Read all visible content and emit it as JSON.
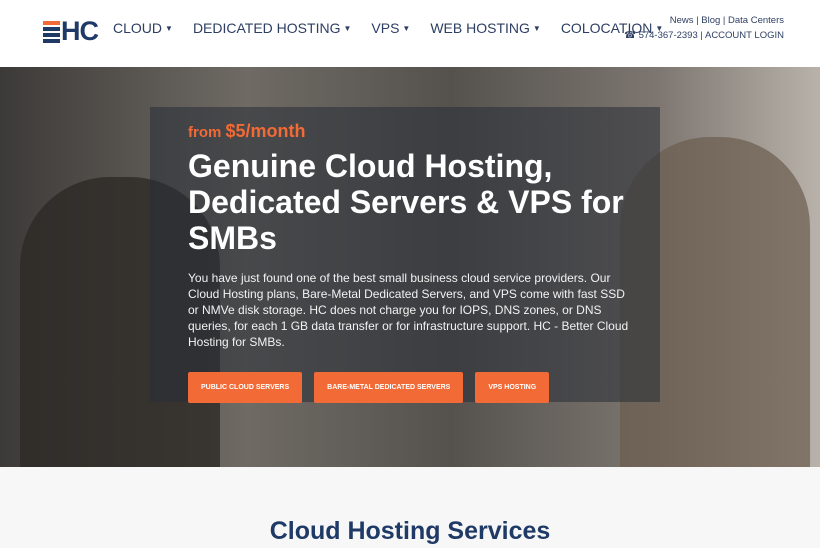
{
  "brand": {
    "logo_text": "HC"
  },
  "nav": [
    {
      "label": "CLOUD"
    },
    {
      "label": "DEDICATED HOSTING"
    },
    {
      "label": "VPS"
    },
    {
      "label": "WEB HOSTING"
    },
    {
      "label": "COLOCATION"
    }
  ],
  "top_links": {
    "news": "News",
    "blog": "Blog",
    "data_centers": "Data Centers",
    "phone": "574-367-2393",
    "account": "ACCOUNT LOGIN",
    "sep": "|"
  },
  "hero": {
    "from": "from",
    "price": "$5/month",
    "title": "Genuine Cloud Hosting, Dedicated Servers & VPS for SMBs",
    "description": "You have just found one of the best small business cloud service providers. Our Cloud Hosting plans, Bare-Metal Dedicated Servers, and VPS come with fast SSD or NMVe disk storage. HC does not charge you for IOPS, DNS zones, or DNS queries, for each 1 GB data transfer or for infrastructure support. HC - Better Cloud Hosting for SMBs.",
    "buttons": [
      {
        "label": "PUBLIC CLOUD SERVERS"
      },
      {
        "label": "BARE-METAL DEDICATED SERVERS"
      },
      {
        "label": "VPS HOSTING"
      }
    ]
  },
  "section": {
    "title": "Cloud Hosting Services"
  },
  "colors": {
    "accent": "#f26a36",
    "navy": "#1f3a66"
  }
}
